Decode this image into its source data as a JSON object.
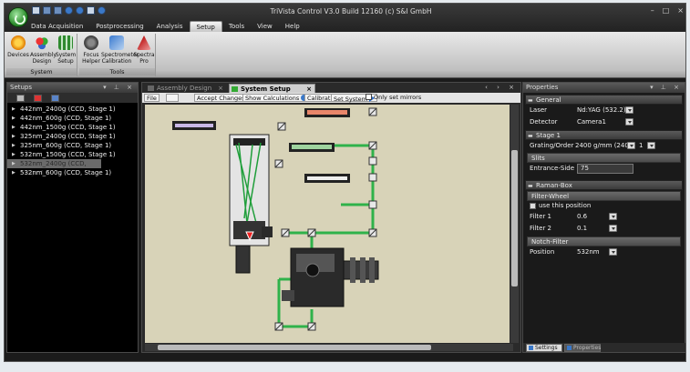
{
  "window": {
    "title": "TriVista Control V3.0 Build 12160 (c) S&I GmbH",
    "controls": [
      "–",
      "□",
      "×"
    ]
  },
  "menu": {
    "tabs": [
      "Data Acquisition",
      "Postprocessing",
      "Analysis",
      "Setup",
      "Tools",
      "View",
      "Help"
    ],
    "active": "Setup"
  },
  "ribbon": {
    "system_group": {
      "label": "System",
      "buttons": [
        {
          "label": "Devices",
          "icon": "devices-icon"
        },
        {
          "label": "Assembly Design",
          "icon": "assembly-icon"
        },
        {
          "label": "System Setup",
          "icon": "system-setup-icon"
        }
      ]
    },
    "tools_group": {
      "label": "Tools",
      "buttons": [
        {
          "label": "Focus Helper",
          "icon": "focus-helper-icon"
        },
        {
          "label": "Spectrometer Calibration",
          "icon": "spectrometer-icon"
        },
        {
          "label": "Spectra Pro",
          "icon": "spectra-pro-icon"
        }
      ]
    }
  },
  "setups_panel": {
    "title": "Setups",
    "items": [
      "442nm_2400g (CCD, Stage 1)",
      "442nm_600g (CCD, Stage 1)",
      "442nm_1500g (CCD, Stage 1)",
      "325nm_2400g (CCD, Stage 1)",
      "325nm_600g (CCD, Stage 1)",
      "532nm_1500g (CCD, Stage 1)",
      "532nm_2400g (CCD, Stage 1)",
      "532nm_600g (CCD, Stage 1)"
    ],
    "selected_index": 6
  },
  "document": {
    "tabs": [
      "Assembly Design",
      "System Setup"
    ],
    "active_tab": "System Setup",
    "toolbar": {
      "file": "File",
      "accept_changes": "Accept Changes",
      "show_calculations": "Show Calculations",
      "calibration": "Calibration",
      "set_system": "Set System",
      "only_set_mirrors": "Only set mirrors"
    }
  },
  "properties": {
    "title": "Properties",
    "general": {
      "header": "General",
      "laser_label": "Laser",
      "laser_value": "Nd:YAG (532.2)",
      "detector_label": "Detector",
      "detector_value": "Camera1"
    },
    "stage1": {
      "header": "Stage 1",
      "grating_label": "Grating/Order",
      "grating_value": "2400 g/mm (240h",
      "order_value": "1",
      "slits_header": "Slits",
      "entrance_label": "Entrance-Side",
      "entrance_value": "75"
    },
    "raman_box": {
      "header": "Raman-Box",
      "filter_wheel_header": "Filter-Wheel",
      "use_position_label": "use this position",
      "filter1_label": "Filter 1",
      "filter1_value": "0.6",
      "filter2_label": "Filter 2",
      "filter2_value": "0.1",
      "notch_header": "Notch-Filter",
      "position_label": "Position",
      "position_value": "532nm"
    },
    "bottom_tabs": [
      "Settings",
      "Properties"
    ]
  },
  "colors": {
    "beam_green": "#2fb24a",
    "canvas_bg": "#d8d3b8",
    "panel_bg": "#000000",
    "ribbon_bg": "#d4d4d4"
  }
}
